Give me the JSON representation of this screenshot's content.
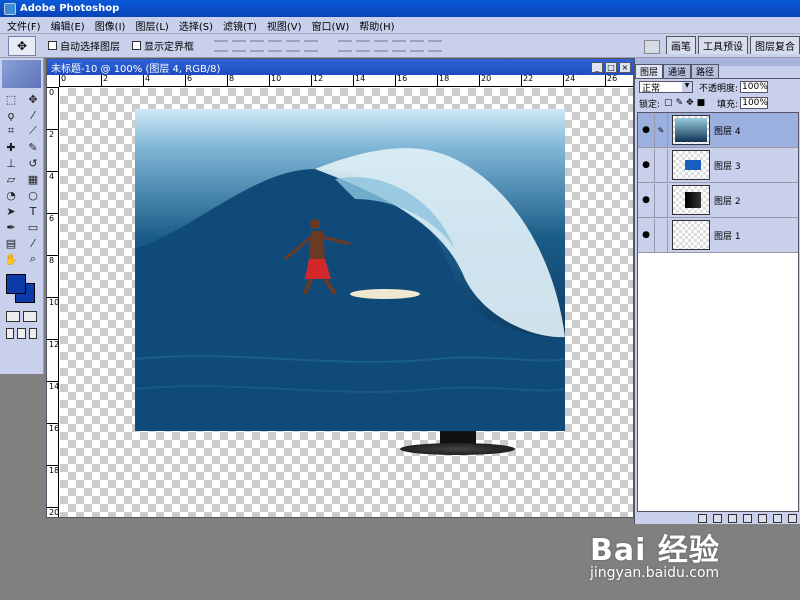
{
  "window": {
    "title": "Adobe Photoshop"
  },
  "menu": [
    "文件(F)",
    "编辑(E)",
    "图像(I)",
    "图层(L)",
    "选择(S)",
    "滤镜(T)",
    "视图(V)",
    "窗口(W)",
    "帮助(H)"
  ],
  "options": {
    "auto_select_label": "自动选择图层",
    "show_bounds_label": "显示定界框"
  },
  "palette_well": {
    "tabs": [
      "画笔",
      "工具预设",
      "图层复合"
    ]
  },
  "document": {
    "title": "未标题-10 @ 100% (图层 4, RGB/8)",
    "ruler_h": [
      "0",
      "2",
      "4",
      "6",
      "8",
      "10",
      "12",
      "14",
      "16",
      "18",
      "20",
      "22",
      "24",
      "26"
    ],
    "ruler_v": [
      "0",
      "2",
      "4",
      "6",
      "8",
      "10",
      "12",
      "14",
      "16",
      "18",
      "20"
    ]
  },
  "layers_panel": {
    "tabs": [
      "图层",
      "通道",
      "路径"
    ],
    "blend_mode": "正常",
    "opacity_label": "不透明度:",
    "opacity": "100%",
    "lock_label": "锁定:",
    "fill_label": "填充:",
    "fill": "100%",
    "layers": [
      {
        "name": "图层 4",
        "active": true,
        "thumb": "surf"
      },
      {
        "name": "图层 3",
        "active": false,
        "thumb": "small"
      },
      {
        "name": "图层 2",
        "active": false,
        "thumb": "monitor"
      },
      {
        "name": "图层 1",
        "active": false,
        "thumb": "empty"
      }
    ]
  },
  "watermark": {
    "brand": "Bai 经验",
    "url": "jingyan.baidu.com"
  },
  "colors": {
    "foreground": "#0c3aa8",
    "background": "#0c3aa8",
    "title_blue": "#0a5ad8",
    "panel_bg": "#c8d0ec"
  },
  "icons": [
    "move-tool-icon",
    "marquee-icon",
    "lasso-icon",
    "crop-icon",
    "brush-icon",
    "eraser-icon",
    "text-icon",
    "hand-icon",
    "zoom-icon",
    "eye-icon"
  ]
}
